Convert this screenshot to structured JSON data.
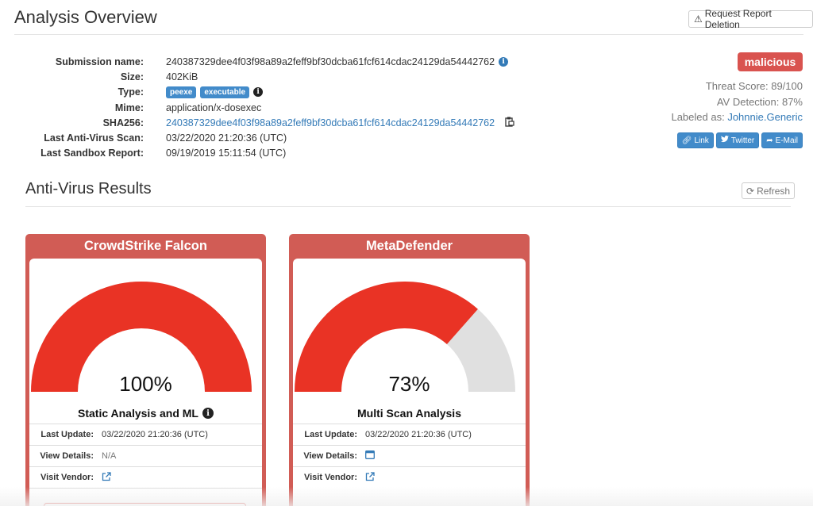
{
  "header": {
    "title": "Analysis Overview",
    "request_deletion_label": "Request Report Deletion"
  },
  "submission": {
    "labels": {
      "name": "Submission name:",
      "size": "Size:",
      "type": "Type:",
      "mime": "Mime:",
      "sha256": "SHA256:",
      "last_av_scan": "Last Anti-Virus Scan:",
      "last_sandbox": "Last Sandbox Report:"
    },
    "name": "240387329dee4f03f98a89a2feff9bf30dcba61fcf614cdac24129da54442762",
    "size": "402KiB",
    "type_tags": [
      "peexe",
      "executable"
    ],
    "mime": "application/x-dosexec",
    "sha256": "240387329dee4f03f98a89a2feff9bf30dcba61fcf614cdac24129da54442762",
    "last_av_scan": "03/22/2020 21:20:36 (UTC)",
    "last_sandbox": "09/19/2019 15:11:54 (UTC)"
  },
  "verdict": {
    "label": "malicious",
    "threat_score": "Threat Score: 89/100",
    "av_detection": "AV Detection: 87%",
    "labeled_as_prefix": "Labeled as:",
    "labeled_as": "Johnnie.Generic"
  },
  "share": {
    "link_label": "Link",
    "twitter_label": "Twitter",
    "email_label": "E-Mail"
  },
  "av_results": {
    "title": "Anti-Virus Results",
    "refresh_label": "Refresh",
    "row_labels": {
      "last_update": "Last Update:",
      "view_details": "View Details:",
      "visit_vendor": "Visit Vendor:"
    },
    "cards": [
      {
        "vendor": "CrowdStrike Falcon",
        "percent_text": "100%",
        "percent": 100,
        "engine": "Static Analysis and ML",
        "last_update": "03/22/2020 21:20:36 (UTC)",
        "view_details": "N/A"
      },
      {
        "vendor": "MetaDefender",
        "percent_text": "73%",
        "percent": 73,
        "engine": "Multi Scan Analysis",
        "last_update": "03/22/2020 21:20:36 (UTC)",
        "view_details": ""
      }
    ]
  },
  "colors": {
    "danger": "#d9534f",
    "gauge_fill": "#e93325",
    "gauge_empty": "#e0e0e0",
    "primary": "#428bca",
    "link": "#337ab7"
  }
}
